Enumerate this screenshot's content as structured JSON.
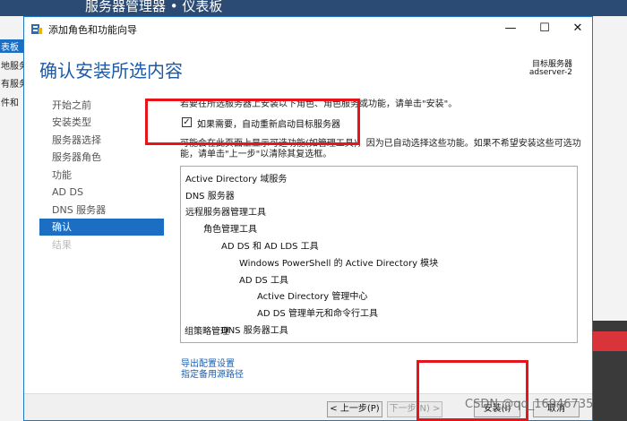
{
  "background": {
    "title": "服务器管理器 • 仪表板",
    "nav": [
      "表板",
      "地服务",
      "有服务",
      "件和"
    ]
  },
  "window": {
    "title": "添加角色和功能向导",
    "controls": {
      "minimize": "—",
      "maximize": "☐",
      "close": "✕"
    }
  },
  "header": {
    "page_title": "确认安装所选内容",
    "target_label": "目标服务器",
    "target_server": "adserver-2"
  },
  "steps": [
    {
      "label": "开始之前",
      "state": "normal"
    },
    {
      "label": "安装类型",
      "state": "normal"
    },
    {
      "label": "服务器选择",
      "state": "normal"
    },
    {
      "label": "服务器角色",
      "state": "normal"
    },
    {
      "label": "功能",
      "state": "normal"
    },
    {
      "label": "AD DS",
      "state": "normal"
    },
    {
      "label": "DNS 服务器",
      "state": "normal"
    },
    {
      "label": "确认",
      "state": "active"
    },
    {
      "label": "结果",
      "state": "disabled"
    }
  ],
  "content": {
    "intro": "若要在所选服务器上安装以下角色、角色服务或功能，请单击\"安装\"。",
    "checkbox_label": "如果需要，自动重新启动目标服务器",
    "checkbox_checked": true,
    "checkbox_mark": "✓",
    "note_line1": "可能会在此页面上显示可选功能(如管理工具)，因为已自动选择这些功能。如果不希望安装这些可选功",
    "note_line2": "能，请单击\"上一步\"以清除其复选框。"
  },
  "features": [
    {
      "label": "Active Directory 域服务",
      "level": 0
    },
    {
      "label": "DNS 服务器",
      "level": 0
    },
    {
      "label": "远程服务器管理工具",
      "level": 0
    },
    {
      "label": "角色管理工具",
      "level": 1
    },
    {
      "label": "AD DS 和 AD LDS 工具",
      "level": 2
    },
    {
      "label": "Windows PowerShell 的 Active Directory 模块",
      "level": 3
    },
    {
      "label": "AD DS 工具",
      "level": 3
    },
    {
      "label": "Active Directory 管理中心",
      "level": 4
    },
    {
      "label": "AD DS 管理单元和命令行工具",
      "level": 4
    },
    {
      "label": "DNS 服务器工具",
      "level": 2
    },
    {
      "label": "组策略管理",
      "level": 0
    }
  ],
  "links": {
    "export": "导出配置设置",
    "alt_source": "指定备用源路径"
  },
  "footer": {
    "prev": "< 上一步(P)",
    "next": "下一步(N) >",
    "install": "安装(I)",
    "cancel": "取消"
  },
  "watermark": "CSDN @qq_16946735"
}
